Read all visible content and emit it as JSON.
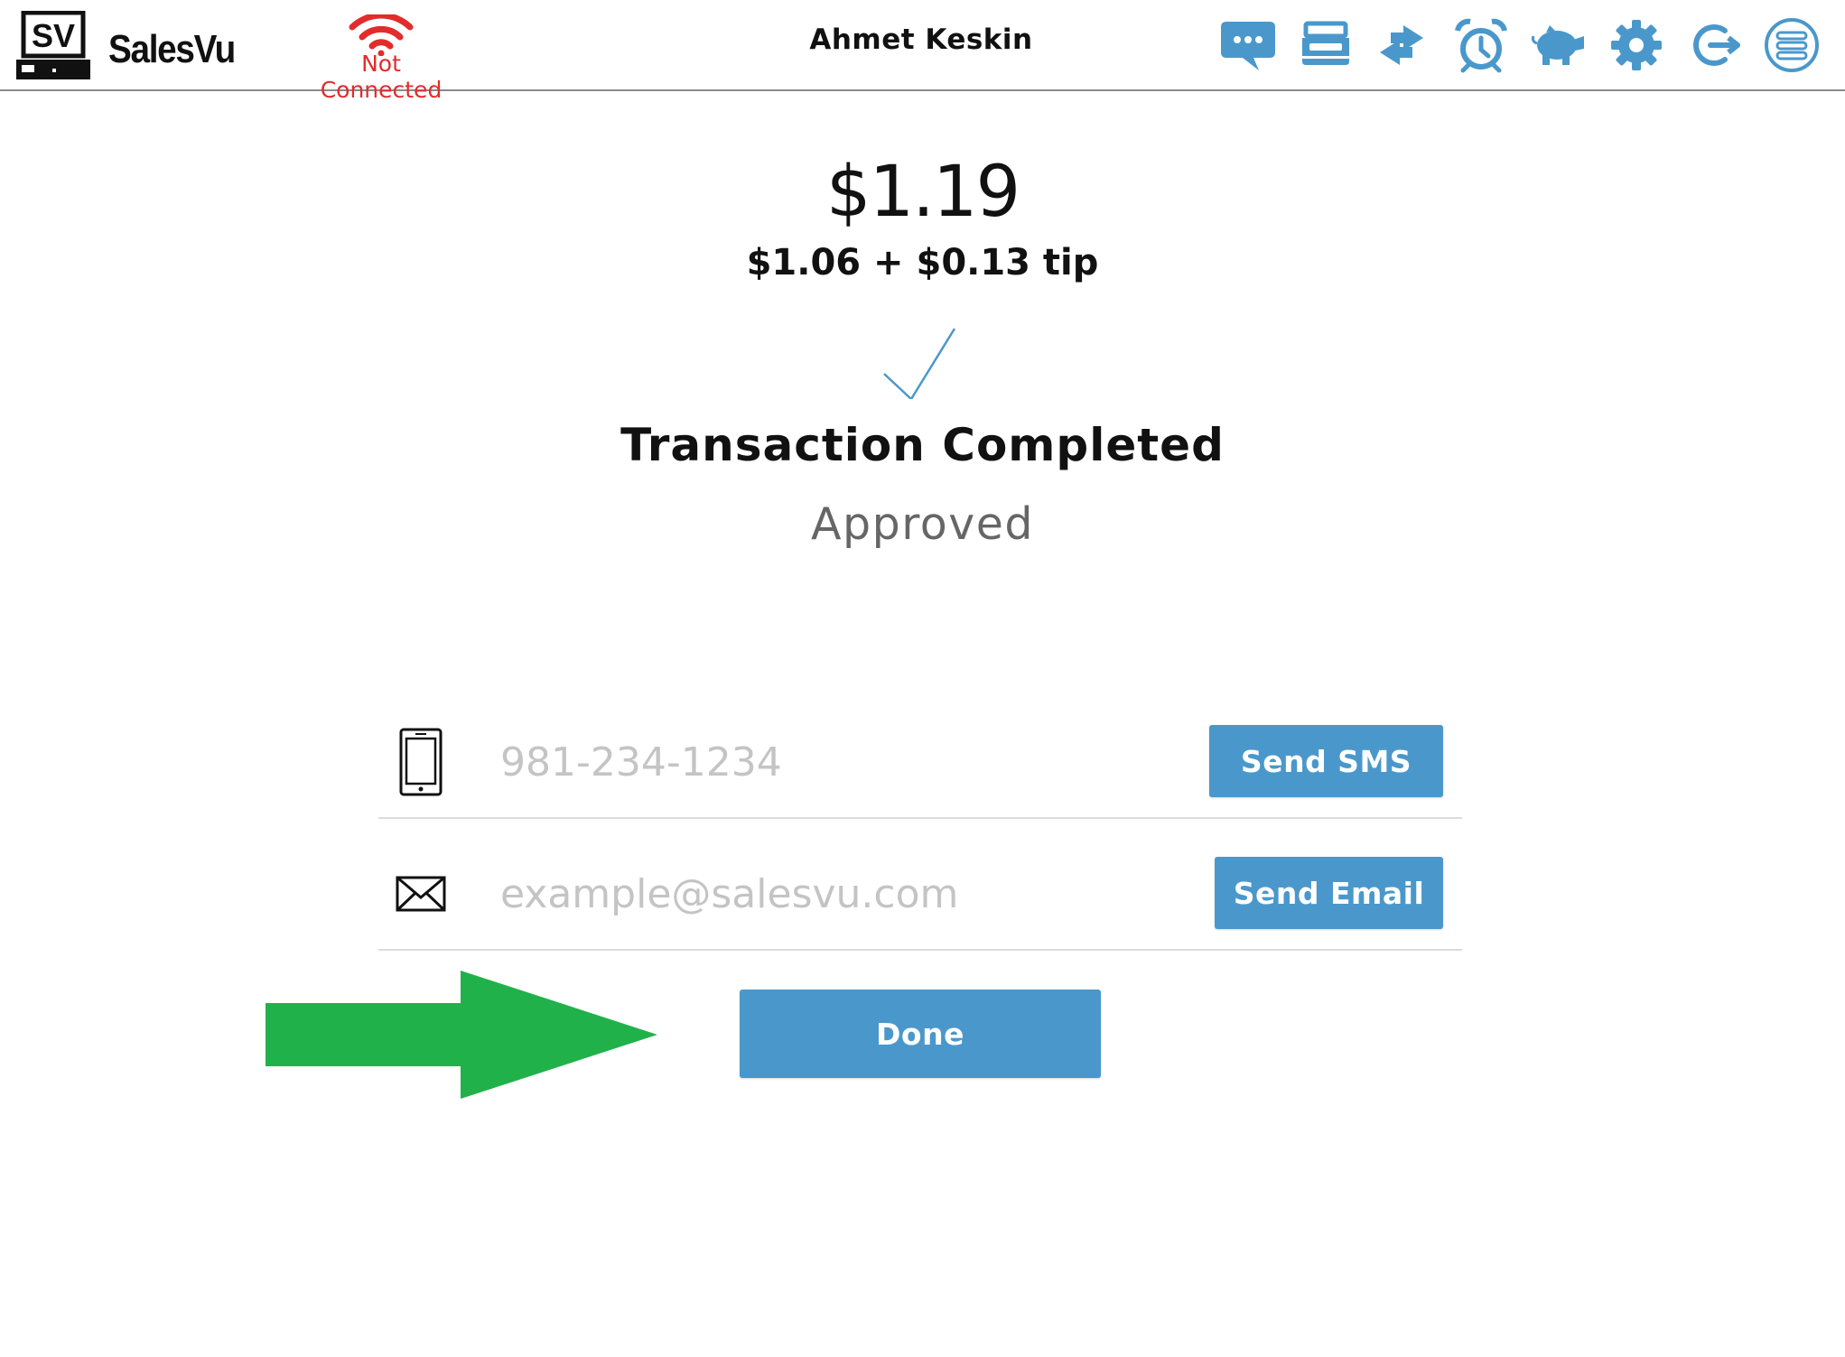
{
  "header": {
    "brand": "SalesVu",
    "logo_text": "SV",
    "connection_status": "Not Connected",
    "user_name": "Ahmet Keskin",
    "icons": [
      "chat-icon",
      "cash-drawer-icon",
      "transfer-icon",
      "alarm-clock-icon",
      "piggy-bank-icon",
      "settings-gear-icon",
      "logout-icon",
      "menu-list-icon"
    ]
  },
  "transaction": {
    "total": "$1.19",
    "breakdown": "$1.06 + $0.13 tip",
    "status": "Transaction Completed",
    "result": "Approved"
  },
  "receipt": {
    "phone_placeholder": "981-234-1234",
    "sms_button": "Send SMS",
    "email_placeholder": "example@salesvu.com",
    "email_button": "Send Email"
  },
  "actions": {
    "done_button": "Done"
  },
  "colors": {
    "accent_blue": "#4a98cb",
    "error_red": "#e32b2b",
    "annotation_green": "#21b14b"
  }
}
